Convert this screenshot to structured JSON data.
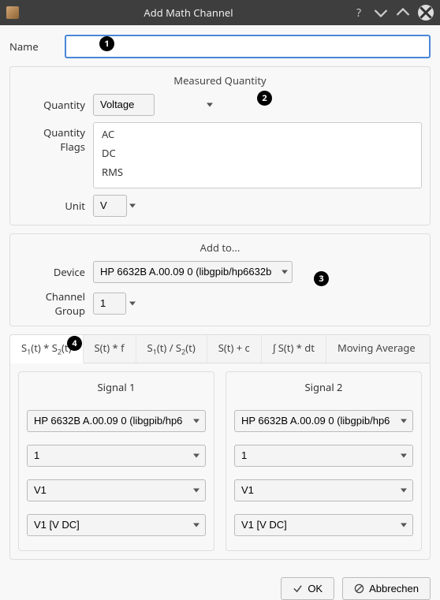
{
  "titlebar": {
    "title": "Add Math Channel"
  },
  "name": {
    "label": "Name",
    "value": ""
  },
  "measured": {
    "title": "Measured Quantity",
    "quantity_label": "Quantity",
    "quantity_value": "Voltage",
    "flags_label": "Quantity Flags",
    "flags": [
      "AC",
      "DC",
      "RMS"
    ],
    "unit_label": "Unit",
    "unit_value": "V"
  },
  "addto": {
    "title": "Add to...",
    "device_label": "Device",
    "device_value": "HP 6632B A.00.09 0 (libgpib/hp6632b",
    "group_label": "Channel Group",
    "group_value": "1"
  },
  "tabs": {
    "items": [
      {
        "label": "S1(t) * S2(t)",
        "html": "S<sub>1</sub>(t) * S<sub>2</sub>(t)"
      },
      {
        "label": "S(t) * f"
      },
      {
        "label": "S1(t) / S2(t)",
        "html": "S<sub>1</sub>(t) / S<sub>2</sub>(t)"
      },
      {
        "label": "S(t) + c"
      },
      {
        "label": "∫ S(t) * dt"
      },
      {
        "label": "Moving Average"
      }
    ],
    "active": 0
  },
  "signal1": {
    "title": "Signal 1",
    "device": "HP 6632B A.00.09 0 (libgpib/hp6",
    "group": "1",
    "channel": "V1",
    "measure": "V1 [V DC]"
  },
  "signal2": {
    "title": "Signal 2",
    "device": "HP 6632B A.00.09 0 (libgpib/hp6",
    "group": "1",
    "channel": "V1",
    "measure": "V1 [V DC]"
  },
  "buttons": {
    "ok": "OK",
    "cancel": "Abbrechen"
  },
  "badges": {
    "b1": "1",
    "b2": "2",
    "b3": "3",
    "b4": "4"
  }
}
